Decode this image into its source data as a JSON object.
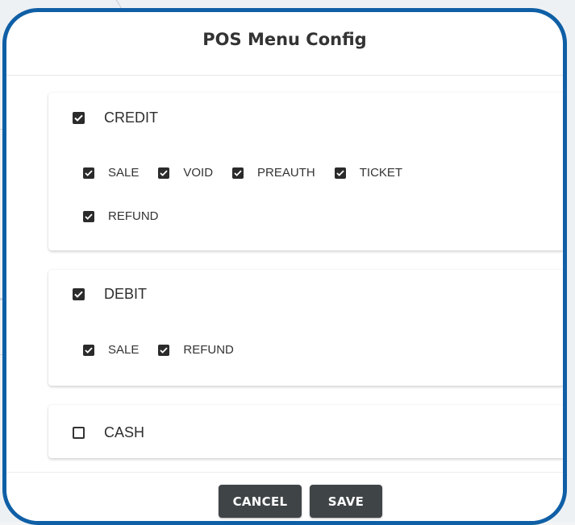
{
  "dialog": {
    "title": "POS Menu Config"
  },
  "sections": [
    {
      "label": "CREDIT",
      "checked": true,
      "options": [
        {
          "label": "SALE",
          "checked": true
        },
        {
          "label": "VOID",
          "checked": true
        },
        {
          "label": "PREAUTH",
          "checked": true
        },
        {
          "label": "TICKET",
          "checked": true
        },
        {
          "label": "REFUND",
          "checked": true
        }
      ]
    },
    {
      "label": "DEBIT",
      "checked": true,
      "options": [
        {
          "label": "SALE",
          "checked": true
        },
        {
          "label": "REFUND",
          "checked": true
        }
      ]
    },
    {
      "label": "CASH",
      "checked": false,
      "options": []
    }
  ],
  "actions": {
    "cancel_label": "CANCEL",
    "save_label": "SAVE"
  },
  "colors": {
    "dialog_border": "#0f5fa6",
    "checkbox_fill": "#2b2b2b",
    "button_bg": "#3f4447"
  }
}
